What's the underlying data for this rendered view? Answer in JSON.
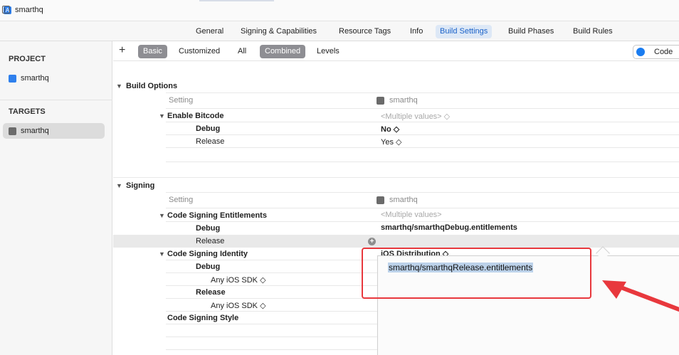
{
  "window": {
    "title": "smarthq"
  },
  "tabs": [
    {
      "label": "General"
    },
    {
      "label": "Signing & Capabilities"
    },
    {
      "label": "Resource Tags"
    },
    {
      "label": "Info"
    },
    {
      "label": "Build Settings"
    },
    {
      "label": "Build Phases"
    },
    {
      "label": "Build Rules"
    }
  ],
  "sidebar": {
    "project_header": "PROJECT",
    "project_item": "smarthq",
    "targets_header": "TARGETS",
    "target_item": "smarthq"
  },
  "filter": {
    "add_label": "+",
    "basic": "Basic",
    "customized": "Customized",
    "all": "All",
    "combined": "Combined",
    "levels": "Levels",
    "code_label": "Code"
  },
  "build_options": {
    "title": "Build Options",
    "setting_header": "Setting",
    "target_header": "smarthq",
    "enable_bitcode": "Enable Bitcode",
    "multiple_values": "<Multiple values> ◇",
    "debug_label": "Debug",
    "debug_value": "No ◇",
    "release_label": "Release",
    "release_value": "Yes ◇"
  },
  "signing": {
    "title": "Signing",
    "setting_header": "Setting",
    "target_header": "smarthq",
    "entitlements_label": "Code Signing Entitlements",
    "entitlements_multiple": "<Multiple values>",
    "ent_debug_label": "Debug",
    "ent_debug_value": "smarthq/smarthqDebug.entitlements",
    "ent_release_label": "Release",
    "identity_label": "Code Signing Identity",
    "identity_value": "iOS Distribution ◇",
    "id_debug_label": "Debug",
    "id_debug_sdk": "Any iOS SDK ◇",
    "id_release_label": "Release",
    "id_release_sdk": "Any iOS SDK ◇",
    "style_label": "Code Signing Style"
  },
  "editor": {
    "value": "smarthq/smarthqRelease.entitlements"
  },
  "colors": {
    "accent": "#1a62c9",
    "annotation": "#e8383d",
    "selection": "#bcd2ea"
  }
}
